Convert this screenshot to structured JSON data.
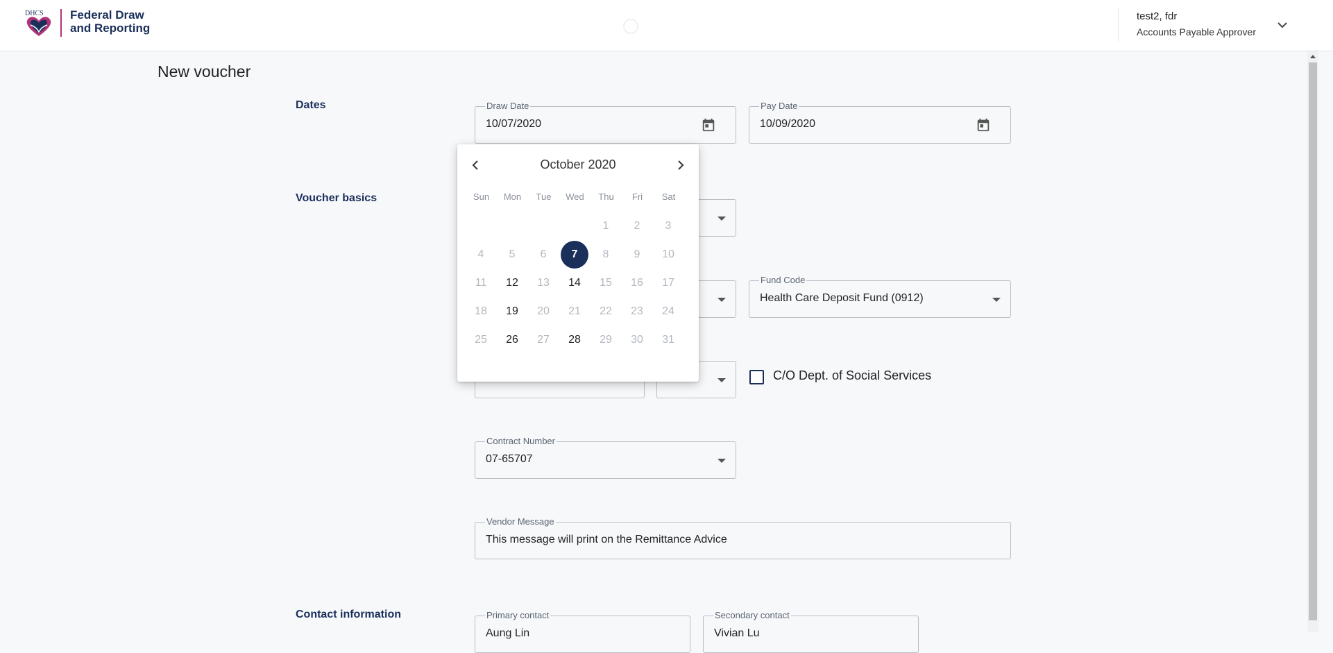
{
  "header": {
    "logo_text": "DHCS",
    "brand_line1": "Federal Draw",
    "brand_line2": "and Reporting",
    "user_name": "test2, fdr",
    "user_role": "Accounts Payable Approver"
  },
  "page": {
    "title": "New voucher"
  },
  "sections": {
    "dates": "Dates",
    "voucher_basics": "Voucher basics",
    "contact_information": "Contact information"
  },
  "fields": {
    "draw_date": {
      "label": "Draw Date",
      "value": "10/07/2020"
    },
    "pay_date": {
      "label": "Pay Date",
      "value": "10/09/2020"
    },
    "fund_code": {
      "label": "Fund Code",
      "value": "Health Care Deposit Fund (0912)"
    },
    "contract_number": {
      "label": "Contract Number",
      "value": "07-65707"
    },
    "vendor_message": {
      "label": "Vendor Message",
      "value": "This message will print on the Remittance Advice"
    },
    "primary_contact": {
      "label": "Primary contact",
      "value": "Aung Lin"
    },
    "secondary_contact": {
      "label": "Secondary contact",
      "value": "Vivian Lu"
    },
    "co_dss": {
      "label": "C/O Dept. of Social Services",
      "checked": false
    }
  },
  "datepicker": {
    "month_label": "October 2020",
    "weekdays": [
      "Sun",
      "Mon",
      "Tue",
      "Wed",
      "Thu",
      "Fri",
      "Sat"
    ],
    "weeks": [
      [
        "",
        "",
        "",
        "",
        "1",
        "2",
        "3"
      ],
      [
        "4",
        "5",
        "6",
        "7",
        "8",
        "9",
        "10"
      ],
      [
        "11",
        "12",
        "13",
        "14",
        "15",
        "16",
        "17"
      ],
      [
        "18",
        "19",
        "20",
        "21",
        "22",
        "23",
        "24"
      ],
      [
        "25",
        "26",
        "27",
        "28",
        "29",
        "30",
        "31"
      ]
    ],
    "selected_day": "7",
    "enabled_days": [
      "7",
      "12",
      "14",
      "19",
      "26",
      "28"
    ]
  },
  "colors": {
    "brand_navy": "#1b2f5b",
    "brand_magenta": "#b0337a",
    "background": "#f7f8fa"
  },
  "icons": {
    "calendar": "calendar-icon",
    "chevron_left": "chevron-left-icon",
    "chevron_right": "chevron-right-icon",
    "chevron_down": "chevron-down-icon",
    "dropdown": "dropdown-caret-icon"
  }
}
